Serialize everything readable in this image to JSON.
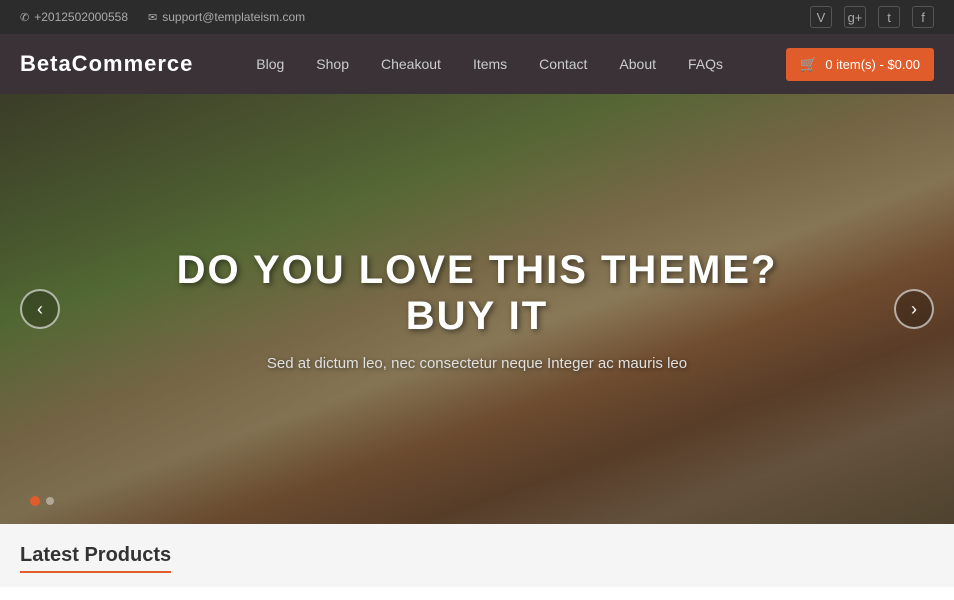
{
  "topbar": {
    "phone": "+2012502000558",
    "email": "support@templateism.com",
    "social": [
      {
        "name": "vimeo",
        "icon": "V"
      },
      {
        "name": "google-plus",
        "icon": "g+"
      },
      {
        "name": "twitter",
        "icon": "t"
      },
      {
        "name": "facebook",
        "icon": "f"
      }
    ]
  },
  "header": {
    "logo": "BetaCommerce",
    "nav": [
      {
        "label": "Blog",
        "href": "#"
      },
      {
        "label": "Shop",
        "href": "#"
      },
      {
        "label": "Cheakout",
        "href": "#"
      },
      {
        "label": "Items",
        "href": "#"
      },
      {
        "label": "Contact",
        "href": "#"
      },
      {
        "label": "About",
        "href": "#"
      },
      {
        "label": "FAQs",
        "href": "#"
      }
    ],
    "cart": {
      "label": "0 item(s) - $0.00"
    }
  },
  "hero": {
    "title": "DO YOU LOVE THIS THEME? BUY IT",
    "subtitle": "Sed at dictum leo, nec consectetur neque Integer ac mauris leo",
    "arrow_left": "‹",
    "arrow_right": "›",
    "dots": [
      {
        "active": true
      },
      {
        "active": false
      }
    ]
  },
  "below": {
    "section_title": "Latest Products"
  }
}
